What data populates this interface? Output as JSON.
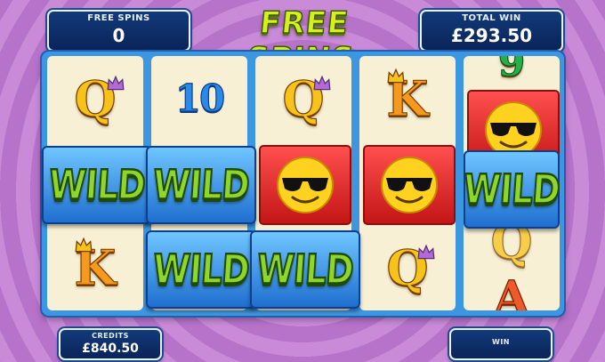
{
  "header": {
    "free_spins_label": "FREE SPINS",
    "free_spins_value": "0",
    "title": "FREE SPINS",
    "total_win_label": "TOTAL WIN",
    "total_win_value": "£293.50"
  },
  "reels": [
    [
      "Q",
      "WILD",
      "K"
    ],
    [
      "10",
      "WILD",
      "WILD"
    ],
    [
      "Q",
      "smiley-sunglasses-icon",
      "WILD"
    ],
    [
      "K",
      "smiley-sunglasses-icon",
      "Q"
    ],
    [
      "9",
      "smiley-sunglasses-icon",
      "WILD",
      "Q",
      "A"
    ]
  ],
  "symbols": {
    "wild": "WILD",
    "q": "Q",
    "k": "K",
    "ten": "10",
    "nine": "9",
    "a": "A"
  },
  "footer": {
    "credits_label": "CREDITS",
    "credits_value": "£840.50",
    "win_label": "WIN"
  },
  "colors": {
    "background": "#c98ad8",
    "panel": "#123a7a",
    "reel_frame": "#3d97e0",
    "reel_bg": "#f7f0d4",
    "title": "#d6f01c",
    "wild_text": "#8fd62c",
    "smiley_tile": "#e02424"
  }
}
